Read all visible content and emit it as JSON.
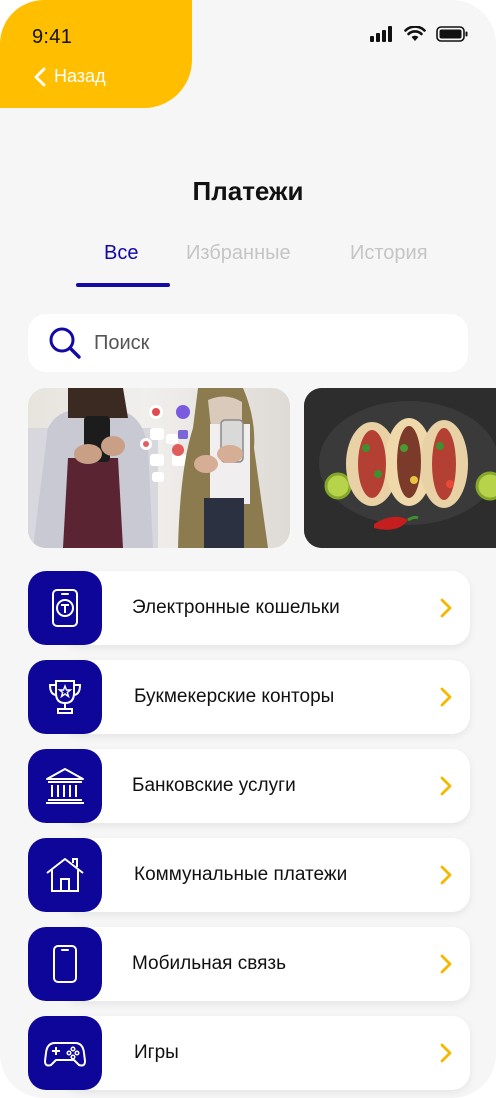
{
  "status_bar": {
    "time": "9:41"
  },
  "header": {
    "back_label": "Назад",
    "title": "Платежи"
  },
  "tabs": [
    {
      "label": "Все",
      "active": true
    },
    {
      "label": "Избранные",
      "active": false
    },
    {
      "label": "История",
      "active": false
    }
  ],
  "search": {
    "placeholder": "Поиск",
    "value": ""
  },
  "banners": [
    {
      "name": "people-with-phones"
    },
    {
      "name": "tacos-food"
    }
  ],
  "categories": [
    {
      "label": "Электронные кошельки",
      "icon": "wallet-phone-icon"
    },
    {
      "label": "Букмекерские конторы",
      "icon": "trophy-icon"
    },
    {
      "label": "Банковские услуги",
      "icon": "bank-icon"
    },
    {
      "label": "Коммунальные платежи",
      "icon": "house-icon"
    },
    {
      "label": "Мобильная связь",
      "icon": "mobile-phone-icon"
    },
    {
      "label": "Игры",
      "icon": "gamepad-icon"
    }
  ],
  "colors": {
    "accent_yellow": "#ffbf00",
    "primary_blue": "#0d0699",
    "tab_active": "#1209a8",
    "chevron": "#f5b800"
  }
}
